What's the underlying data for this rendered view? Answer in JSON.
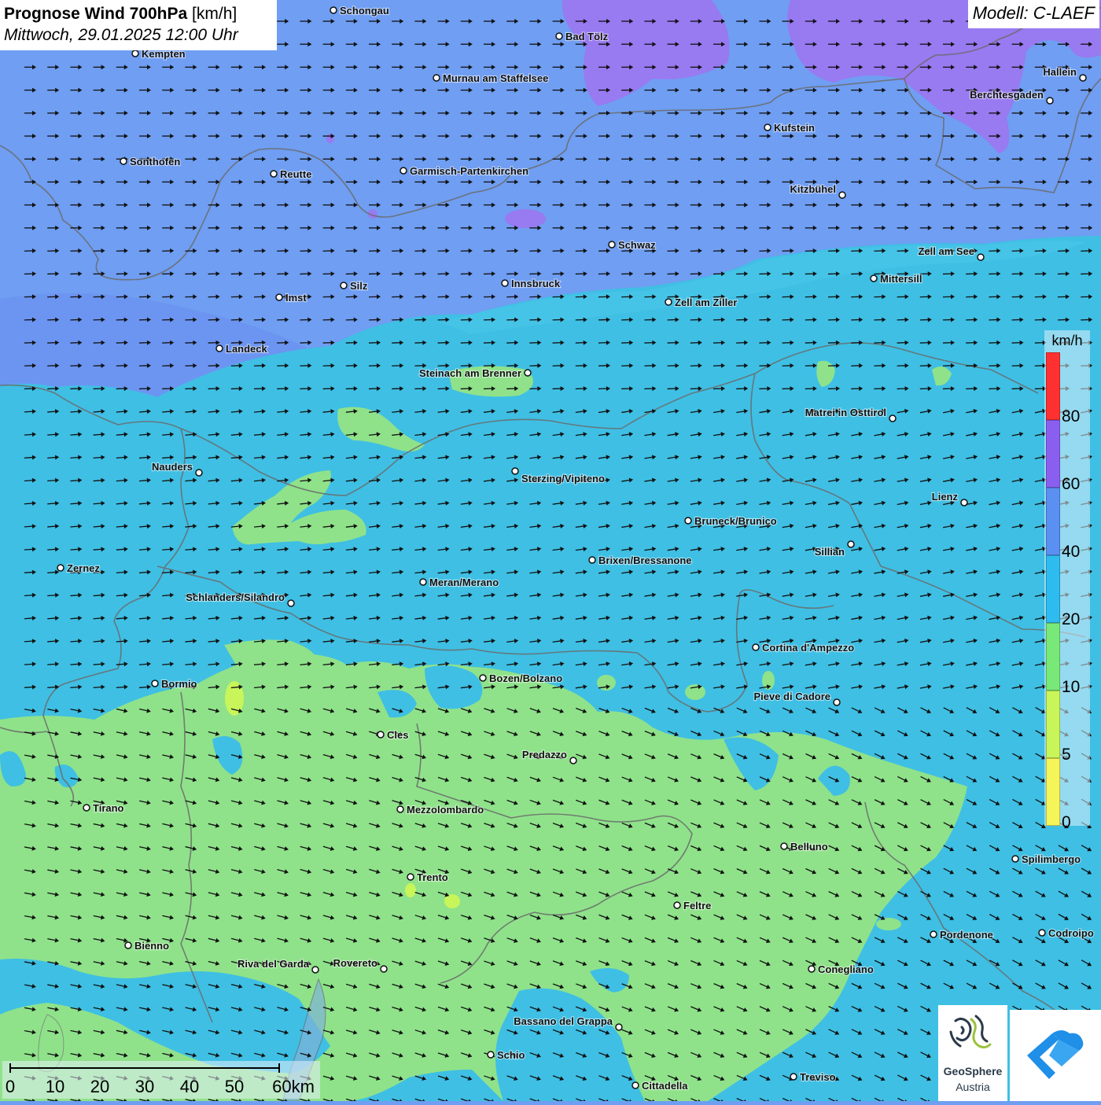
{
  "header": {
    "title_main": "Prognose Wind 700hPa",
    "title_unit": " [km/h]",
    "datetime": "Mittwoch, 29.01.2025 12:00 Uhr",
    "model": "Modell: C-LAEF"
  },
  "legend": {
    "unit": "km/h",
    "ticks": [
      "80",
      "60",
      "40",
      "20",
      "10",
      "5",
      "0"
    ],
    "colors": [
      "#ff3030",
      "#8a5ff0",
      "#5a90f2",
      "#2ebcf0",
      "#78e878",
      "#c8f55a",
      "#f5f55a"
    ]
  },
  "scalebar": {
    "labels": [
      "0",
      "10",
      "20",
      "30",
      "40",
      "50",
      "60km"
    ]
  },
  "colors": {
    "wind_5_10": "#b8ee6a",
    "wind_10_20": "#8fe28a",
    "wind_20_40": "#3fbfe4",
    "wind_40_60": "#6f9ef2",
    "wind_60_80": "#9a78f0",
    "wind_arrow": "#111111",
    "border": "#6b6b6b"
  },
  "logos": {
    "geosphere_name": "GeoSphere",
    "geosphere_sub": "Austria"
  },
  "cities": [
    {
      "name": "Schongau"
    },
    {
      "name": "Bad Tölz"
    },
    {
      "name": "Kempten"
    },
    {
      "name": "Murnau am Staffelsee"
    },
    {
      "name": "Hallein"
    },
    {
      "name": "Berchtesgaden"
    },
    {
      "name": "Kufstein"
    },
    {
      "name": "Sonthofen"
    },
    {
      "name": "Reutte"
    },
    {
      "name": "Garmisch-Partenkirchen"
    },
    {
      "name": "Kitzbühel"
    },
    {
      "name": "Schwaz"
    },
    {
      "name": "Zell am See"
    },
    {
      "name": "Mittersill"
    },
    {
      "name": "Innsbruck"
    },
    {
      "name": "Silz"
    },
    {
      "name": "Imst"
    },
    {
      "name": "Zell am Ziller"
    },
    {
      "name": "Landeck"
    },
    {
      "name": "Steinach am Brenner"
    },
    {
      "name": "Matrei in Osttirol"
    },
    {
      "name": "Nauders"
    },
    {
      "name": "Sterzing/Vipiteno"
    },
    {
      "name": "Lienz"
    },
    {
      "name": "Bruneck/Brunico"
    },
    {
      "name": "Sillian"
    },
    {
      "name": "Brixen/Bressanone"
    },
    {
      "name": "Zernez"
    },
    {
      "name": "Meran/Merano"
    },
    {
      "name": "Schlanders/Silandro"
    },
    {
      "name": "Cortina d'Ampezzo"
    },
    {
      "name": "Bozen/Bolzano"
    },
    {
      "name": "Bormio"
    },
    {
      "name": "Pieve di Cadore"
    },
    {
      "name": "Cles"
    },
    {
      "name": "Predazzo"
    },
    {
      "name": "Tirano"
    },
    {
      "name": "Mezzolombardo"
    },
    {
      "name": "Belluno"
    },
    {
      "name": "Spilimbergo"
    },
    {
      "name": "Trento"
    },
    {
      "name": "Feltre"
    },
    {
      "name": "Pordenone"
    },
    {
      "name": "Codroipo"
    },
    {
      "name": "Bienno"
    },
    {
      "name": "Riva del Garda"
    },
    {
      "name": "Rovereto"
    },
    {
      "name": "Conegliano"
    },
    {
      "name": "Bassano del Grappa"
    },
    {
      "name": "Schio"
    },
    {
      "name": "Treviso"
    },
    {
      "name": "Cittadella"
    }
  ]
}
